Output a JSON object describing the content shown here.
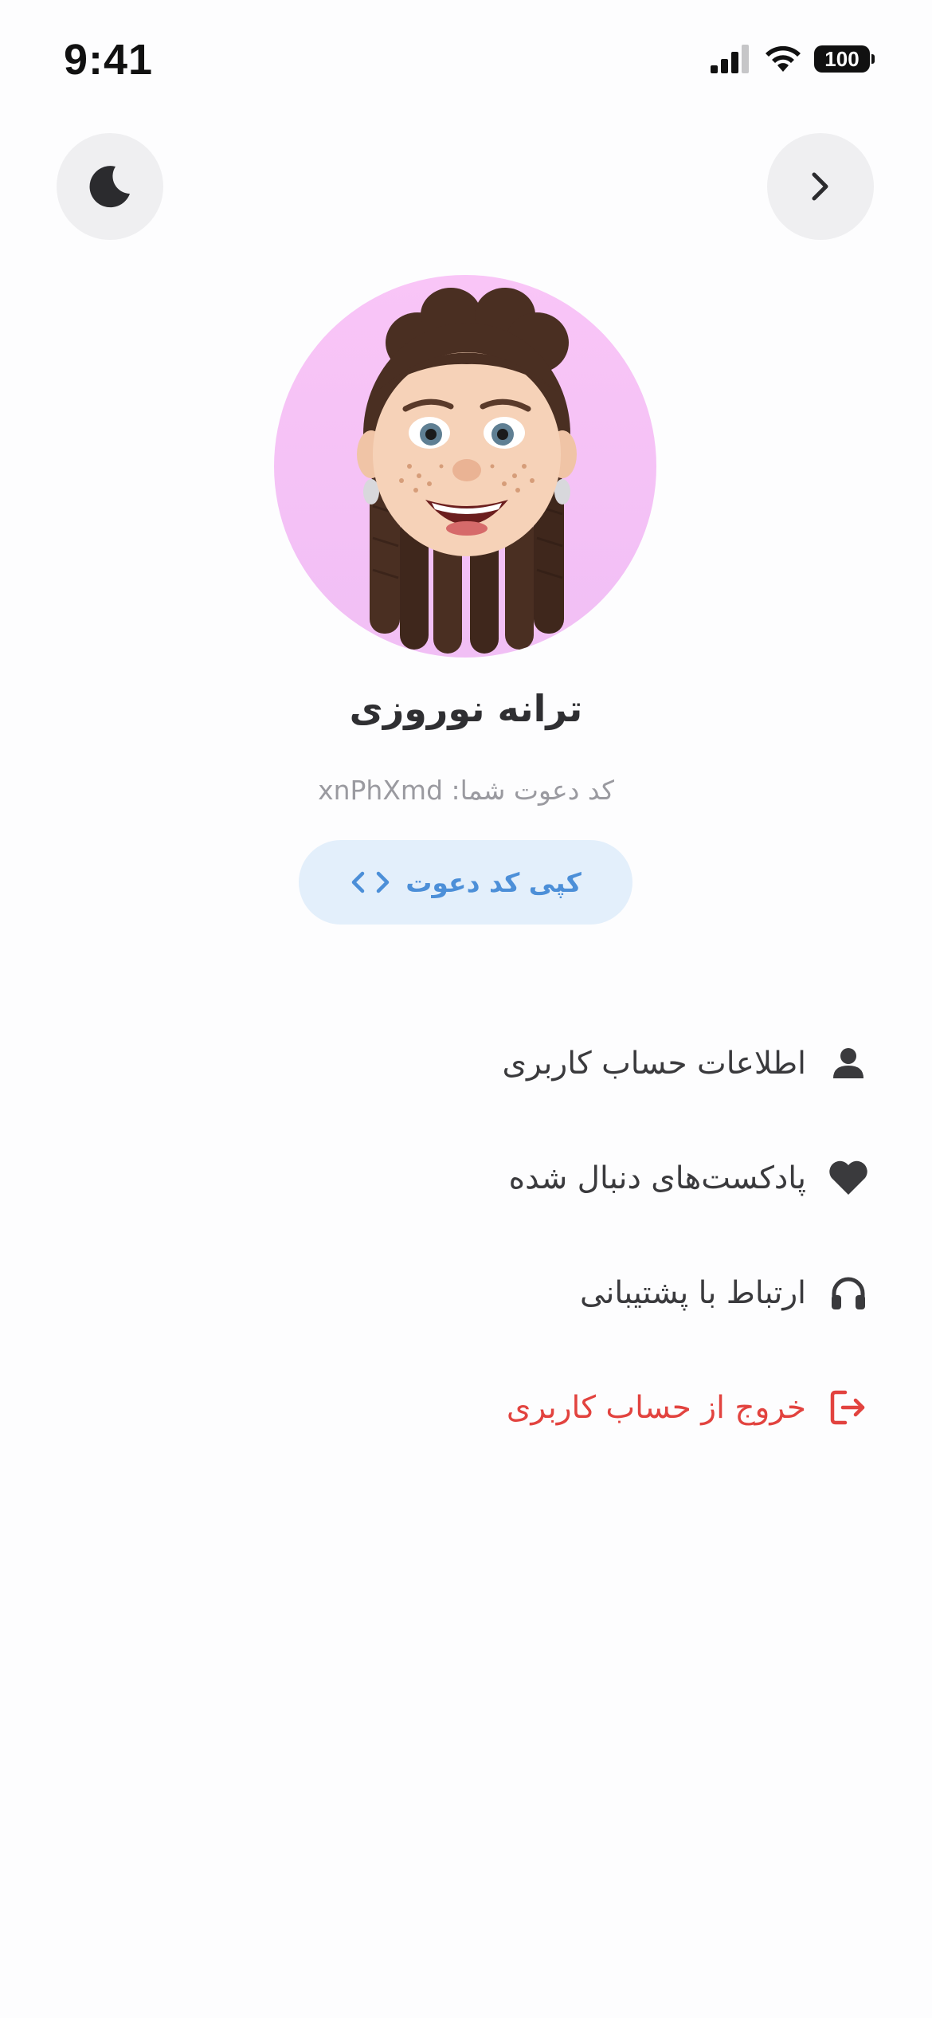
{
  "status_bar": {
    "time": "9:41",
    "battery": "100"
  },
  "header": {
    "theme_toggle_icon": "moon-icon",
    "next_icon": "chevron-right-icon"
  },
  "profile": {
    "avatar": "memoji-avatar",
    "name": "ترانه نوروزی",
    "invite_code_text": "کد دعوت شما: xnPhXmd",
    "copy_button_label": "کپی کد دعوت",
    "copy_button_icon": "code-brackets-icon"
  },
  "colors": {
    "accent": "#4c8fd8",
    "accent_bg": "#e3effb",
    "danger": "#e2433f",
    "avatar_bg": "#f9c5f7"
  },
  "menu": {
    "items": [
      {
        "label": "اطلاعات حساب کاربری",
        "icon": "user-icon"
      },
      {
        "label": "پادکست‌های دنبال شده",
        "icon": "heart-icon"
      },
      {
        "label": "ارتباط با پشتیبانی",
        "icon": "headphones-icon"
      },
      {
        "label": "خروج از حساب کاربری",
        "icon": "logout-icon"
      }
    ]
  }
}
